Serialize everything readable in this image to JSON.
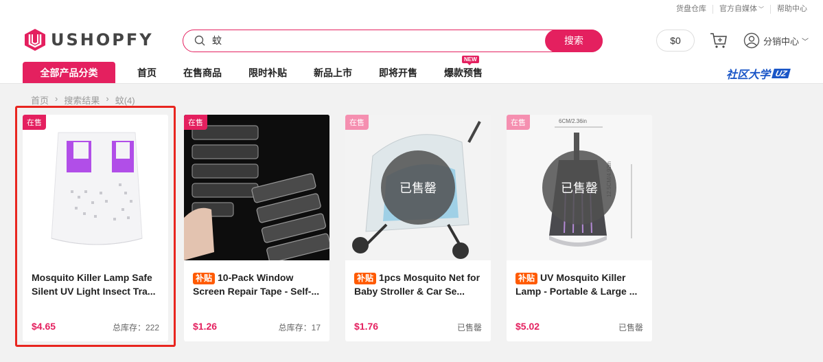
{
  "topbar": {
    "links": [
      "货盘仓库",
      "官方自媒体",
      "帮助中心"
    ]
  },
  "brand": {
    "name": "USHOPFY",
    "accent": "#e4205f"
  },
  "search": {
    "query": "蚊",
    "button_label": "搜索"
  },
  "header": {
    "balance": "$0",
    "distribution_center": "分销中心"
  },
  "nav": {
    "all_categories": "全部产品分类",
    "items": [
      "首页",
      "在售商品",
      "限时补贴",
      "新品上市",
      "即将开售",
      "爆款预售"
    ],
    "new_badge": "NEW",
    "university": "社区大学",
    "university_logo": "UZ"
  },
  "breadcrumb": [
    "首页",
    "搜索结果",
    "蚊(4)"
  ],
  "products": [
    {
      "tag": "在售",
      "subsidy": "",
      "title": "Mosquito Killer Lamp Safe Silent UV Light Insect Tra...",
      "price": "$4.65",
      "stock": "总库存：222",
      "sold_out": false
    },
    {
      "tag": "在售",
      "subsidy": "补贴",
      "title": "10-Pack Window Screen Repair Tape - Self-...",
      "price": "$1.26",
      "stock": "总库存：17",
      "sold_out": false
    },
    {
      "tag": "在售",
      "subsidy": "补贴",
      "title": "1pcs Mosquito Net for Baby Stroller & Car Se...",
      "price": "$1.76",
      "stock": "已售罄",
      "sold_out": true,
      "overlay": "已售罄"
    },
    {
      "tag": "在售",
      "subsidy": "补贴",
      "title": "UV Mosquito Killer Lamp - Portable & Large ...",
      "price": "$5.02",
      "stock": "已售罄",
      "sold_out": true,
      "overlay": "已售罄",
      "dim_width": "6CM/2.36in",
      "dim_height": "12.5CM/4.92in"
    }
  ]
}
